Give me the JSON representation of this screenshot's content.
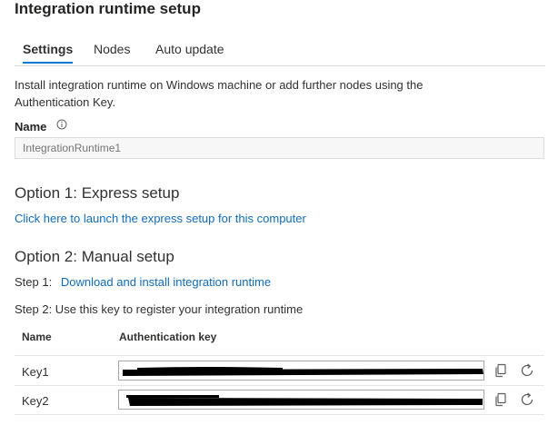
{
  "page": {
    "title": "Integration runtime setup",
    "tabs": [
      {
        "label": "Settings"
      },
      {
        "label": "Nodes"
      },
      {
        "label": "Auto update"
      }
    ],
    "description": "Install integration runtime on Windows machine or add further nodes using the Authentication Key.",
    "name_field": {
      "label": "Name",
      "info_icon": "info-icon",
      "placeholder": "IntegrationRuntime1"
    }
  },
  "option1": {
    "heading": "Option 1: Express setup",
    "link": "Click here to launch the express setup for this computer"
  },
  "option2": {
    "heading": "Option 2: Manual setup",
    "step1_prefix": "Step 1:",
    "step1_link": "Download and install integration runtime",
    "step2": "Step 2: Use this key to register your integration runtime"
  },
  "keys_table": {
    "headers": {
      "name": "Name",
      "key": "Authentication key"
    },
    "rows": [
      {
        "name": "Key1",
        "copy_icon": "copy-icon",
        "refresh_icon": "refresh-icon"
      },
      {
        "name": "Key2",
        "copy_icon": "copy-icon",
        "refresh_icon": "refresh-icon"
      }
    ]
  },
  "colors": {
    "link": "#0f6cbd",
    "tab_underline": "#0078d4",
    "redaction": "#000000"
  }
}
